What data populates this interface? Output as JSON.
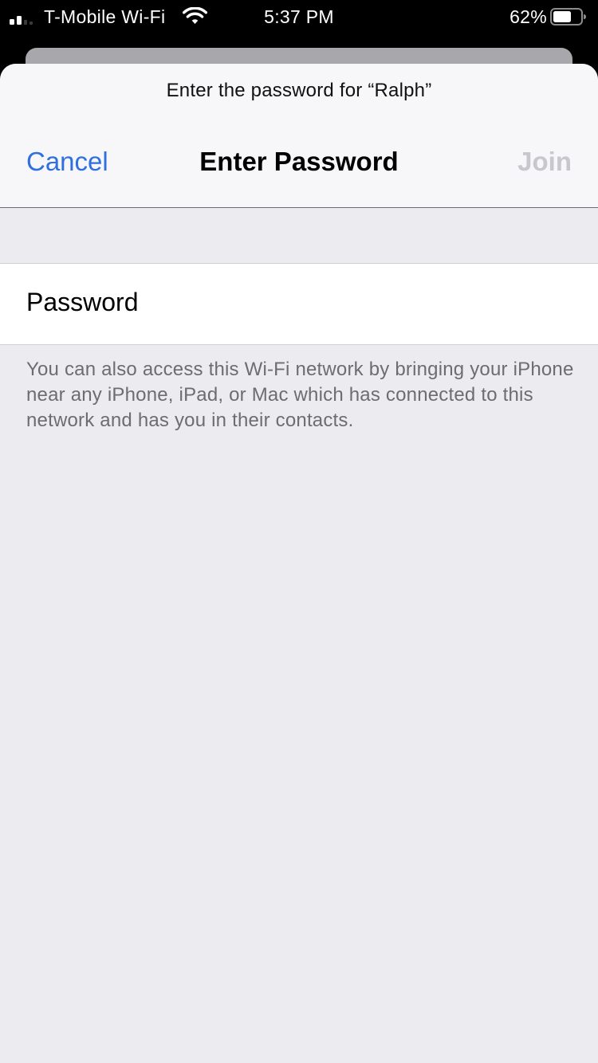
{
  "status_bar": {
    "carrier": "T-Mobile Wi-Fi",
    "time": "5:37 PM",
    "battery_percent": "62%",
    "signal_icon": "cellular-signal-icon",
    "wifi_icon": "wifi-icon",
    "battery_icon": "battery-icon"
  },
  "sheet": {
    "prompt": "Enter the password for “Ralph”",
    "nav": {
      "cancel_label": "Cancel",
      "title": "Enter Password",
      "join_label": "Join"
    },
    "password_field": {
      "label": "Password",
      "value": "",
      "placeholder": ""
    },
    "footnote": "You can also access this Wi-Fi network by bringing your iPhone near any iPhone, iPad, or Mac which has connected to this network and has you in their contacts."
  },
  "colors": {
    "accent": "#2f6fe0",
    "disabled": "#c7c7cc",
    "sheet_background": "#ebebf0",
    "nav_background": "#f7f7f9",
    "footnote_text": "#6c6c72"
  }
}
